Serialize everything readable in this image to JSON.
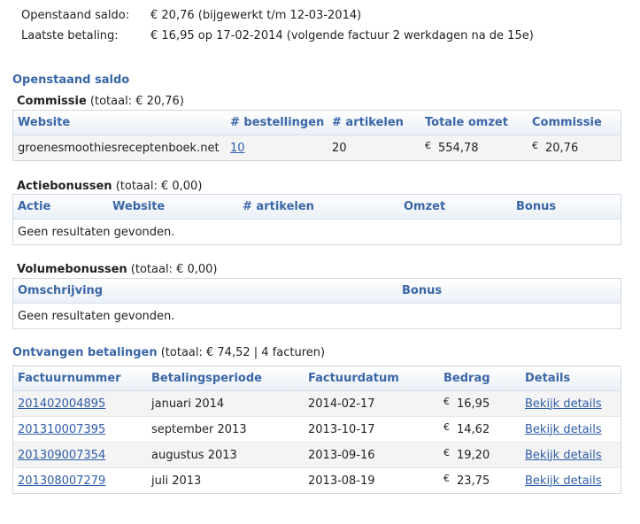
{
  "summary": {
    "open_label": "Openstaand saldo:",
    "open_value": "€ 20,76 (bijgewerkt t/m 12-03-2014)",
    "last_label": "Laatste betaling:",
    "last_value": "€ 16,95 op 17-02-2014 (volgende factuur 2 werkdagen na de 15e)"
  },
  "open_section": {
    "title": "Openstaand saldo"
  },
  "commission": {
    "title": "Commissie",
    "total": "(totaal: € 20,76)",
    "headers": [
      "Website",
      "# bestellingen",
      "# artikelen",
      "Totale omzet",
      "Commissie"
    ],
    "row": {
      "website": "groenesmoothiesreceptenboek.net",
      "orders": "10",
      "articles": "20",
      "currency": "€",
      "revenue": "554,78",
      "commission": "20,76"
    }
  },
  "action_bonus": {
    "title": "Actiebonussen",
    "total": "(totaal: € 0,00)",
    "headers": [
      "Actie",
      "Website",
      "# artikelen",
      "Omzet",
      "Bonus"
    ],
    "empty": "Geen resultaten gevonden."
  },
  "volume_bonus": {
    "title": "Volumebonussen",
    "total": "(totaal: € 0,00)",
    "headers": [
      "Omschrijving",
      "Bonus"
    ],
    "empty": "Geen resultaten gevonden."
  },
  "payments": {
    "title": "Ontvangen betalingen",
    "total": "(totaal: € 74,52 | 4 facturen)",
    "headers": [
      "Factuurnummer",
      "Betalingsperiode",
      "Factuurdatum",
      "Bedrag",
      "Details"
    ],
    "currency": "€",
    "rows": [
      {
        "invoice": "201402004895",
        "period": "januari 2014",
        "date": "2014-02-17",
        "amount": "16,95",
        "details": "Bekijk details"
      },
      {
        "invoice": "201310007395",
        "period": "september 2013",
        "date": "2013-10-17",
        "amount": "14,62",
        "details": "Bekijk details"
      },
      {
        "invoice": "201309007354",
        "period": "augustus 2013",
        "date": "2013-09-16",
        "amount": "19,20",
        "details": "Bekijk details"
      },
      {
        "invoice": "201308007279",
        "period": "juli 2013",
        "date": "2013-08-19",
        "amount": "23,75",
        "details": "Bekijk details"
      }
    ]
  }
}
